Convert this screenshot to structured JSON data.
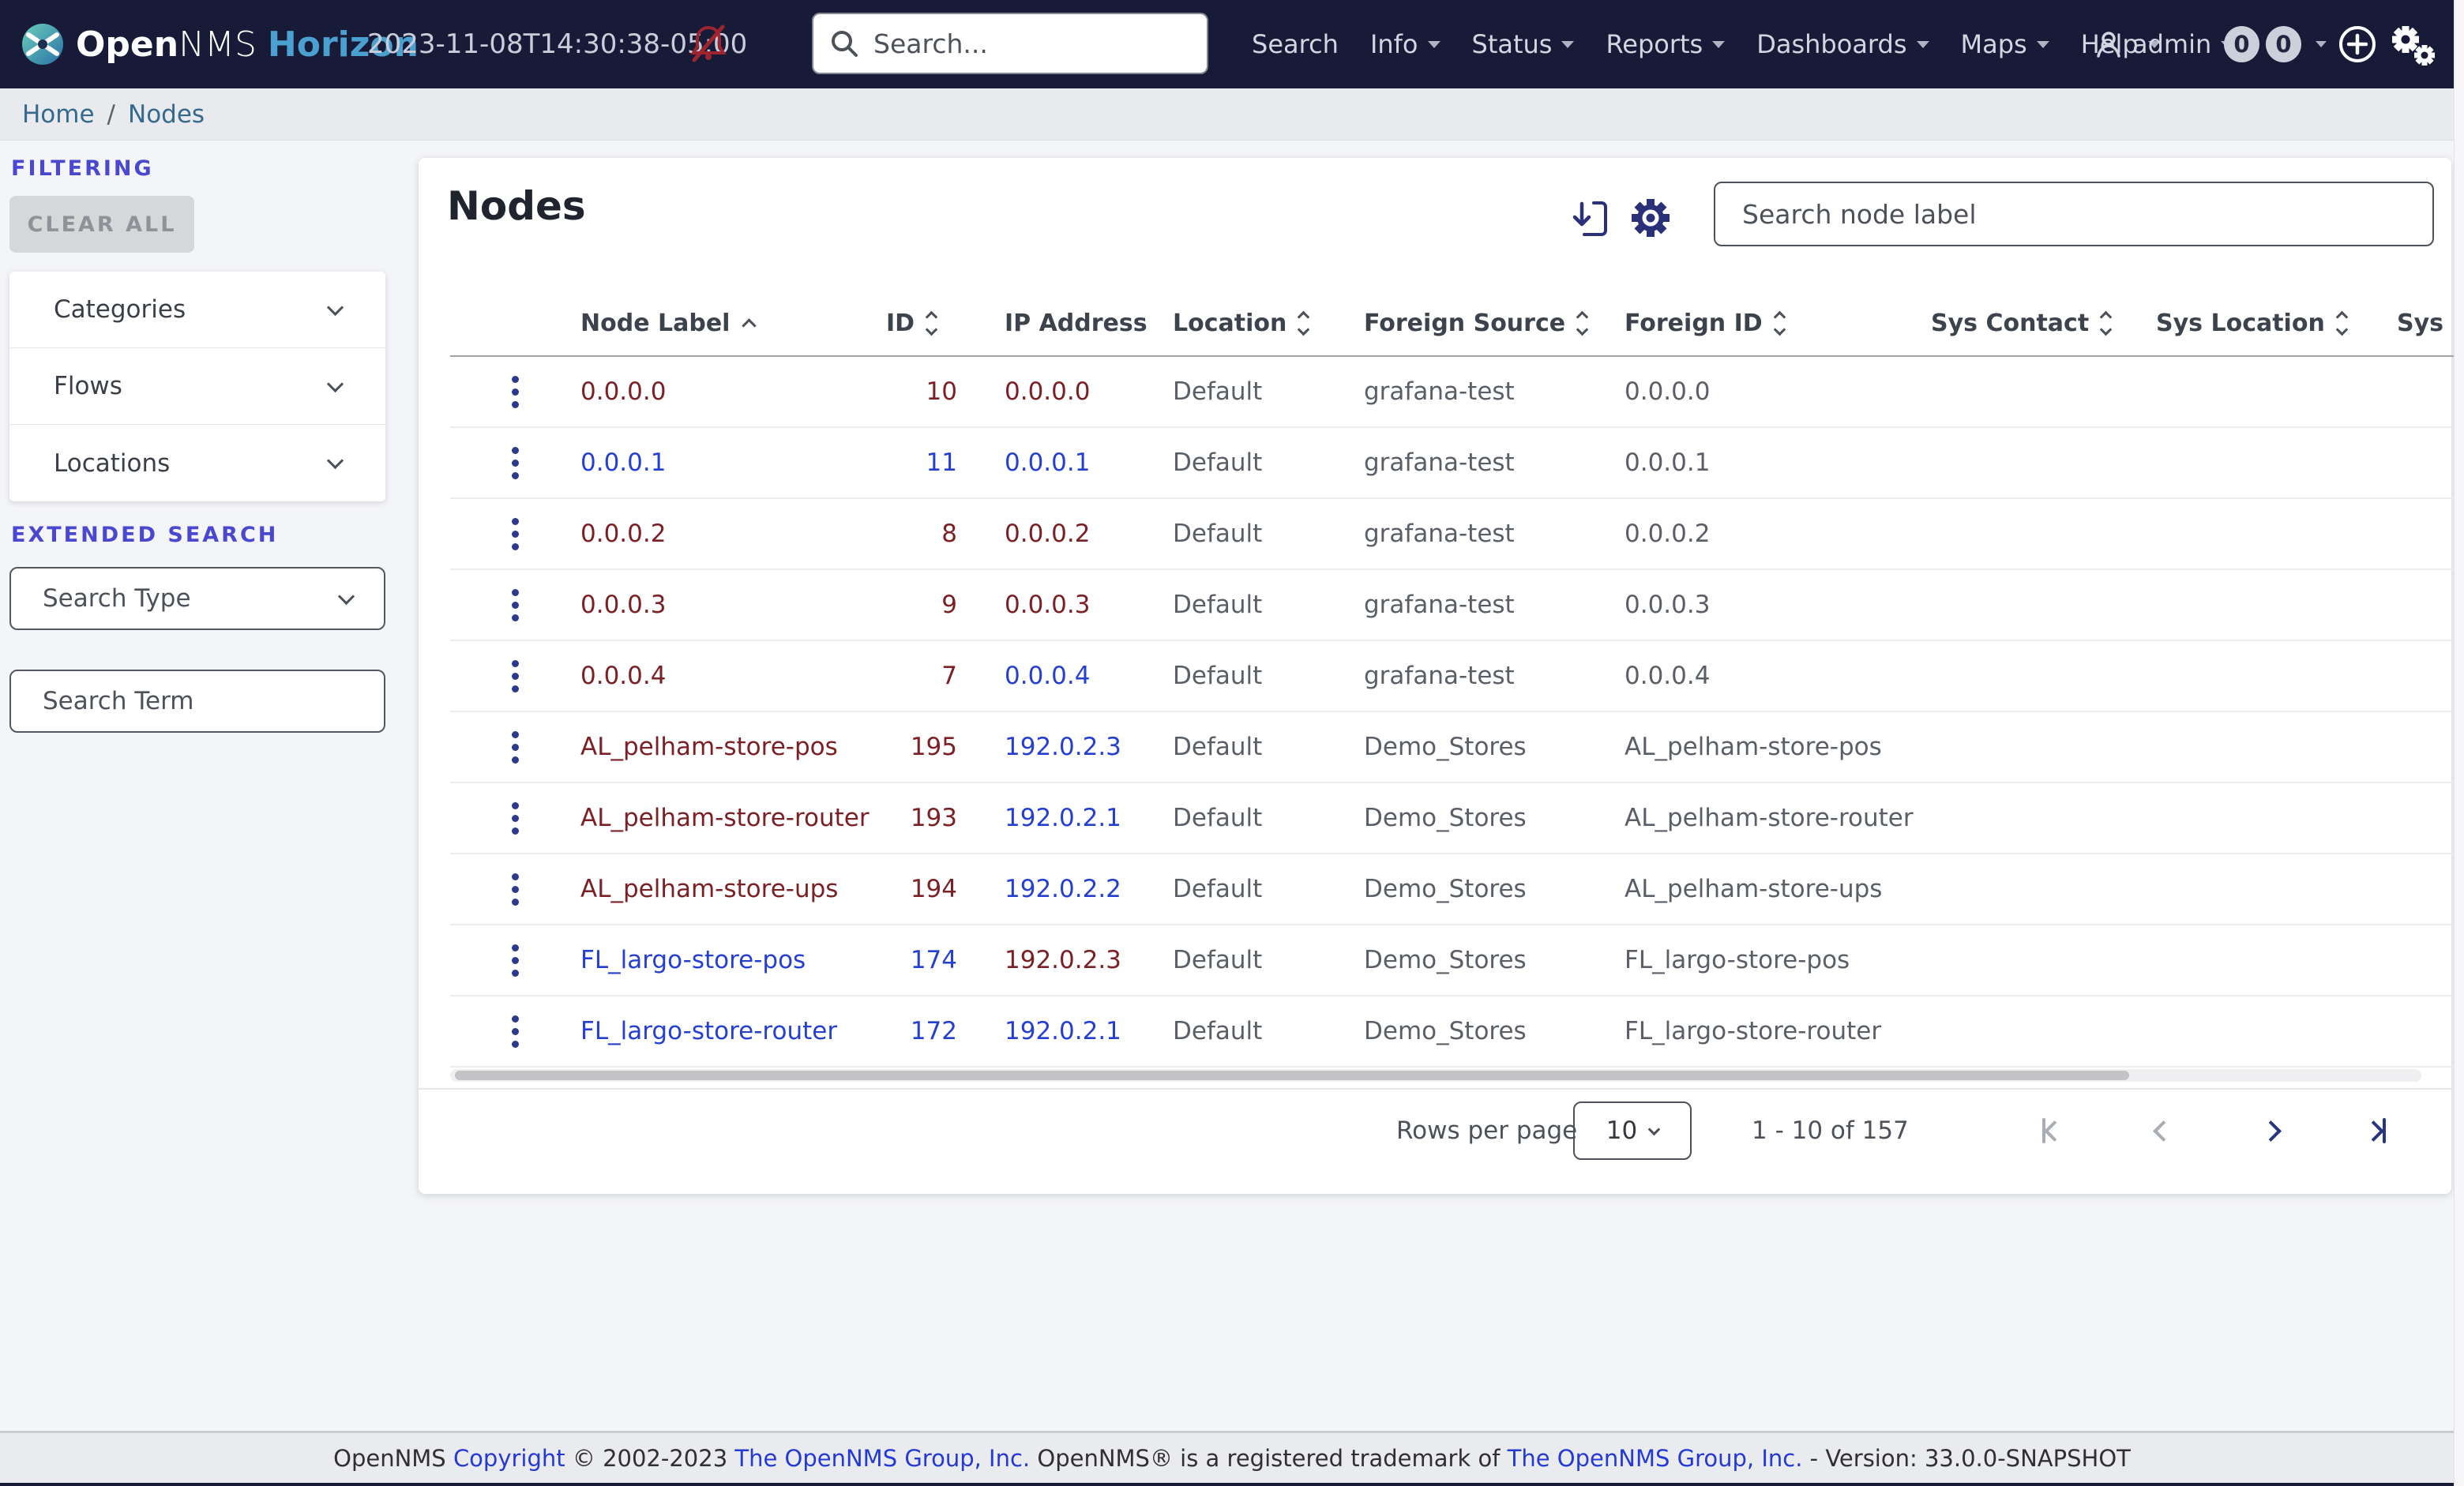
{
  "colors": {
    "navbar_bg": "#181b37",
    "accent_indigo": "#4a48ce",
    "link_blue": "#2540d0",
    "link_red": "#7b2125",
    "brand_blue": "#4aa0cf",
    "icon_navy": "#2a3178",
    "muted_bell_red": "#9c2530",
    "text_gray": "#5a5f67",
    "header_text": "#3d434d",
    "page_bg": "#f4f5f9"
  },
  "navbar": {
    "brand": {
      "open": "Open",
      "nms": "NMS",
      "product": "Horizon"
    },
    "timestamp": "2023-11-08T14:30:38-05:00",
    "search_placeholder": "Search...",
    "items": [
      {
        "label": "Search",
        "caret": false
      },
      {
        "label": "Info",
        "caret": true
      },
      {
        "label": "Status",
        "caret": true
      },
      {
        "label": "Reports",
        "caret": true
      },
      {
        "label": "Dashboards",
        "caret": true
      },
      {
        "label": "Maps",
        "caret": true
      },
      {
        "label": "Help",
        "caret": true
      }
    ],
    "user": {
      "label": "admin",
      "caret": true
    },
    "badges": [
      "0",
      "0"
    ],
    "icons": [
      "opennms-logo",
      "notifications-muted-bell",
      "search-magnifier",
      "user",
      "plus-circle",
      "gears"
    ]
  },
  "breadcrumb": {
    "items": [
      "Home",
      "Nodes"
    ],
    "separator": "/"
  },
  "sidebar": {
    "filtering_label": "FILTERING",
    "clear_all_label": "CLEAR ALL",
    "accordions": [
      "Categories",
      "Flows",
      "Locations"
    ],
    "extended_search_label": "EXTENDED SEARCH",
    "search_type_placeholder": "Search Type",
    "search_term_placeholder": "Search Term"
  },
  "main": {
    "title": "Nodes",
    "search_placeholder": "Search node label",
    "icons": [
      "download",
      "settings-gear"
    ],
    "table": {
      "columns": [
        {
          "label": "",
          "sort": ""
        },
        {
          "label": "Node Label",
          "sort": "asc"
        },
        {
          "label": "ID",
          "sort": "both"
        },
        {
          "label": "IP Address",
          "sort": ""
        },
        {
          "label": "Location",
          "sort": "both"
        },
        {
          "label": "Foreign Source",
          "sort": "both"
        },
        {
          "label": "Foreign ID",
          "sort": "both"
        },
        {
          "label": "Sys Contact",
          "sort": "both"
        },
        {
          "label": "Sys Location",
          "sort": "both"
        },
        {
          "label": "Sys D",
          "sort": ""
        }
      ],
      "rows": [
        {
          "label": "0.0.0.0",
          "label_color": "red",
          "id": "10",
          "id_color": "red",
          "ip": "0.0.0.0",
          "ip_color": "red",
          "location": "Default",
          "foreign_source": "grafana-test",
          "foreign_id": "0.0.0.0",
          "sys_contact": "",
          "sys_location": ""
        },
        {
          "label": "0.0.0.1",
          "label_color": "blue",
          "id": "11",
          "id_color": "blue",
          "ip": "0.0.0.1",
          "ip_color": "blue",
          "location": "Default",
          "foreign_source": "grafana-test",
          "foreign_id": "0.0.0.1",
          "sys_contact": "",
          "sys_location": ""
        },
        {
          "label": "0.0.0.2",
          "label_color": "red",
          "id": "8",
          "id_color": "red",
          "ip": "0.0.0.2",
          "ip_color": "red",
          "location": "Default",
          "foreign_source": "grafana-test",
          "foreign_id": "0.0.0.2",
          "sys_contact": "",
          "sys_location": ""
        },
        {
          "label": "0.0.0.3",
          "label_color": "red",
          "id": "9",
          "id_color": "red",
          "ip": "0.0.0.3",
          "ip_color": "red",
          "location": "Default",
          "foreign_source": "grafana-test",
          "foreign_id": "0.0.0.3",
          "sys_contact": "",
          "sys_location": ""
        },
        {
          "label": "0.0.0.4",
          "label_color": "red",
          "id": "7",
          "id_color": "red",
          "ip": "0.0.0.4",
          "ip_color": "blue",
          "location": "Default",
          "foreign_source": "grafana-test",
          "foreign_id": "0.0.0.4",
          "sys_contact": "",
          "sys_location": ""
        },
        {
          "label": "AL_pelham-store-pos",
          "label_color": "red",
          "id": "195",
          "id_color": "red",
          "ip": "192.0.2.3",
          "ip_color": "blue",
          "location": "Default",
          "foreign_source": "Demo_Stores",
          "foreign_id": "AL_pelham-store-pos",
          "sys_contact": "",
          "sys_location": ""
        },
        {
          "label": "AL_pelham-store-router",
          "label_color": "red",
          "id": "193",
          "id_color": "red",
          "ip": "192.0.2.1",
          "ip_color": "blue",
          "location": "Default",
          "foreign_source": "Demo_Stores",
          "foreign_id": "AL_pelham-store-router",
          "sys_contact": "",
          "sys_location": ""
        },
        {
          "label": "AL_pelham-store-ups",
          "label_color": "red",
          "id": "194",
          "id_color": "red",
          "ip": "192.0.2.2",
          "ip_color": "blue",
          "location": "Default",
          "foreign_source": "Demo_Stores",
          "foreign_id": "AL_pelham-store-ups",
          "sys_contact": "",
          "sys_location": ""
        },
        {
          "label": "FL_largo-store-pos",
          "label_color": "blue",
          "id": "174",
          "id_color": "blue",
          "ip": "192.0.2.3",
          "ip_color": "red",
          "location": "Default",
          "foreign_source": "Demo_Stores",
          "foreign_id": "FL_largo-store-pos",
          "sys_contact": "",
          "sys_location": ""
        },
        {
          "label": "FL_largo-store-router",
          "label_color": "blue",
          "id": "172",
          "id_color": "blue",
          "ip": "192.0.2.1",
          "ip_color": "blue",
          "location": "Default",
          "foreign_source": "Demo_Stores",
          "foreign_id": "FL_largo-store-router",
          "sys_contact": "",
          "sys_location": ""
        }
      ]
    },
    "pagination": {
      "rows_per_page_label": "Rows per page",
      "rows_per_page_value": "10",
      "range_label": "1 - 10 of 157"
    }
  },
  "footer": {
    "segments": [
      {
        "text": "OpenNMS ",
        "link": false
      },
      {
        "text": "Copyright",
        "link": true
      },
      {
        "text": " © 2002-2023 ",
        "link": false
      },
      {
        "text": "The OpenNMS Group, Inc.",
        "link": true
      },
      {
        "text": " OpenNMS® is a registered trademark of ",
        "link": false
      },
      {
        "text": "The OpenNMS Group, Inc.",
        "link": true
      },
      {
        "text": " - Version: 33.0.0-SNAPSHOT",
        "link": false
      }
    ]
  }
}
